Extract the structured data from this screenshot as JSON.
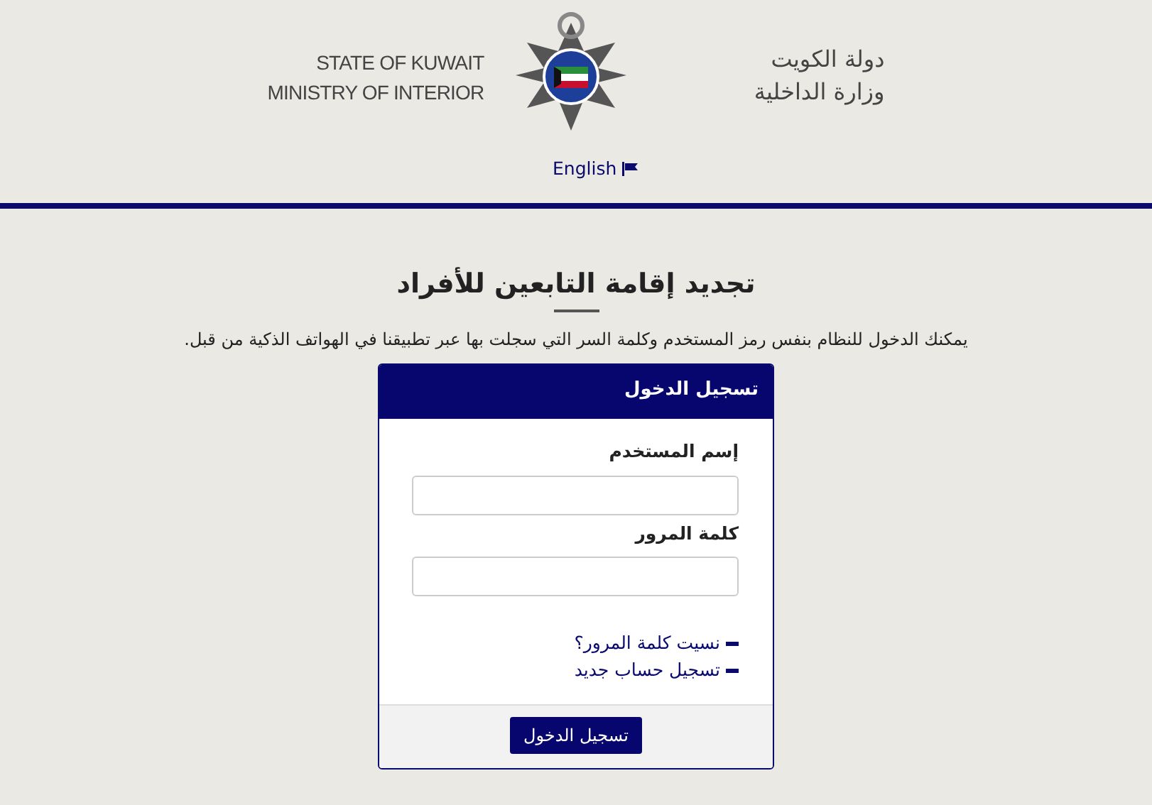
{
  "header": {
    "left_lines": [
      "STATE OF KUWAIT",
      "MINISTRY OF INTERIOR"
    ],
    "right_lines": [
      "دولة الكويت",
      "وزارة الداخلية"
    ],
    "language_link": "English"
  },
  "page": {
    "title": "تجديد إقامة التابعين للأفراد",
    "intro": "يمكنك الدخول للنظام بنفس رمز المستخدم وكلمة السر التي سجلت بها عبر تطبيقنا في الهواتف الذكية من قبل."
  },
  "login_card": {
    "title": "تسجيل الدخول",
    "fields": [
      {
        "label": "إسم المستخدم"
      },
      {
        "label": "كلمة المرور"
      }
    ],
    "links": [
      "نسيت كلمة المرور؟",
      "تسجيل حساب جديد"
    ],
    "submit": "تسجيل الدخول"
  }
}
